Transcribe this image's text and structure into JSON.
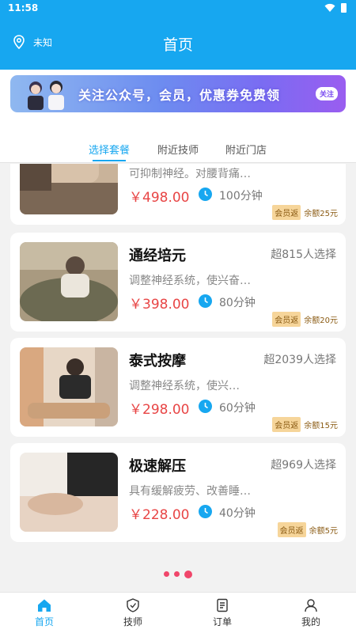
{
  "status_bar": {
    "time": "11:58"
  },
  "header": {
    "location": "未知",
    "title": "首页"
  },
  "banner": {
    "text": "关注公众号，会员，优惠券免费领",
    "follow_label": "关注"
  },
  "tabs": [
    {
      "label": "选择套餐",
      "active": true
    },
    {
      "label": "附近技师",
      "active": false
    },
    {
      "label": "附近门店",
      "active": false
    }
  ],
  "packages": [
    {
      "name": "",
      "count": "",
      "desc": "可抑制神经。对腰背痛…",
      "price": "￥498.00",
      "duration": "100分钟",
      "rebate_tag": "会员返",
      "rebate_amount": "余额25元"
    },
    {
      "name": "通经培元",
      "count": "超815人选择",
      "desc": "调整神经系统，使兴奋…",
      "price": "￥398.00",
      "duration": "80分钟",
      "rebate_tag": "会员返",
      "rebate_amount": "余额20元"
    },
    {
      "name": "泰式按摩",
      "count": "超2039人选择",
      "desc": "调整神经系统，使兴…",
      "price": "￥298.00",
      "duration": "60分钟",
      "rebate_tag": "会员返",
      "rebate_amount": "余额15元"
    },
    {
      "name": "极速解压",
      "count": "超969人选择",
      "desc": "具有缓解疲劳、改善睡…",
      "price": "￥228.00",
      "duration": "40分钟",
      "rebate_tag": "会员返",
      "rebate_amount": "余额5元"
    }
  ],
  "bottom_nav": [
    {
      "label": "首页",
      "icon": "home-icon",
      "active": true
    },
    {
      "label": "技师",
      "icon": "technician-icon",
      "active": false
    },
    {
      "label": "订单",
      "icon": "order-icon",
      "active": false
    },
    {
      "label": "我的",
      "icon": "profile-icon",
      "active": false
    }
  ],
  "colors": {
    "primary": "#17a7f0",
    "price": "#e84545",
    "rebate_bg": "#f6d59a",
    "dot": "#f0466a"
  }
}
